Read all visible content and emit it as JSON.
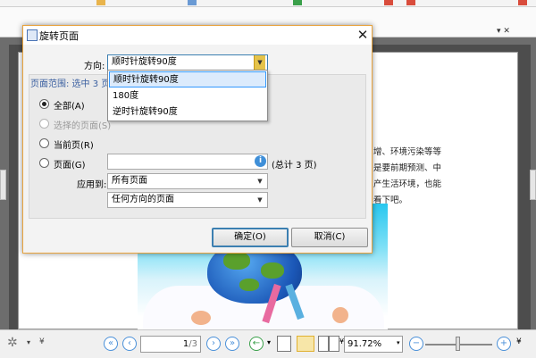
{
  "dialog": {
    "title": "旋转页面",
    "close_glyph": "✕",
    "direction_label": "方向:",
    "direction_value": "顺时针旋转90度",
    "direction_options": [
      "顺时针旋转90度",
      "180度",
      "逆时针旋转90度"
    ],
    "range_header": "页面范围: 选中 3 页",
    "radio_all": "全部(A)",
    "radio_selected": "选择的页面(S)",
    "radio_current": "当前页(R)",
    "radio_pages": "页面(G)",
    "pages_input_value": "",
    "total_pages_note": "(总计 3 页)",
    "apply_to_label": "应用到:",
    "apply_to_value": "所有页面",
    "orientation_value": "任何方向的页面",
    "ok_label": "确定(O)",
    "cancel_label": "取消(C)",
    "info_glyph": "i"
  },
  "document": {
    "line1": "增、环境污染等等",
    "line2": "是要前期预测、中",
    "line3": "产生活环境，也能",
    "line4": "看下吧。"
  },
  "statusbar": {
    "page_value": "1",
    "page_total": "/3",
    "zoom_value": "91.72%"
  },
  "watermark": {
    "text": "Bai 经验"
  },
  "colors": {
    "dialog_border": "#e8a33d",
    "accent_blue": "#3c7fb1",
    "selected_item": "#dcebfc"
  }
}
